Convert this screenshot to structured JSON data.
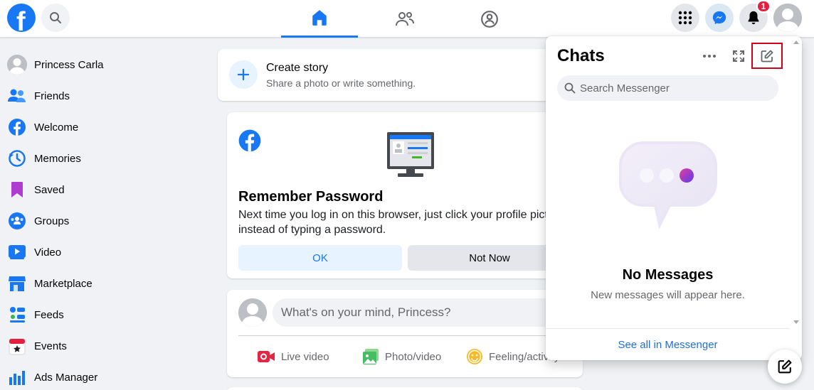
{
  "topbar": {
    "logo_letter": "f",
    "notification_count": "1"
  },
  "sidebar": {
    "items": [
      {
        "label": "Princess Carla",
        "icon": "avatar"
      },
      {
        "label": "Friends",
        "icon": "friends-icon"
      },
      {
        "label": "Welcome",
        "icon": "facebook-icon"
      },
      {
        "label": "Memories",
        "icon": "clock-icon"
      },
      {
        "label": "Saved",
        "icon": "bookmark-icon"
      },
      {
        "label": "Groups",
        "icon": "groups-icon"
      },
      {
        "label": "Video",
        "icon": "video-icon"
      },
      {
        "label": "Marketplace",
        "icon": "marketplace-icon"
      },
      {
        "label": "Feeds",
        "icon": "feeds-icon"
      },
      {
        "label": "Events",
        "icon": "calendar-icon"
      },
      {
        "label": "Ads Manager",
        "icon": "chart-icon"
      }
    ]
  },
  "story": {
    "title": "Create story",
    "subtitle": "Share a photo or write something."
  },
  "remember_password": {
    "title": "Remember Password",
    "text": "Next time you log in on this browser, just click your profile picture instead of typing a password.",
    "ok_label": "OK",
    "not_now_label": "Not Now"
  },
  "composer": {
    "placeholder": "What's on your mind, Princess?",
    "actions": [
      {
        "label": "Live video"
      },
      {
        "label": "Photo/video"
      },
      {
        "label": "Feeling/activity"
      }
    ]
  },
  "chats": {
    "title": "Chats",
    "search_placeholder": "Search Messenger",
    "empty_title": "No Messages",
    "empty_subtitle": "New messages will appear here.",
    "footer_link": "See all in Messenger"
  },
  "colors": {
    "brand": "#1877f2",
    "notification": "#e41e3f",
    "highlight_box": "#d0021b"
  }
}
